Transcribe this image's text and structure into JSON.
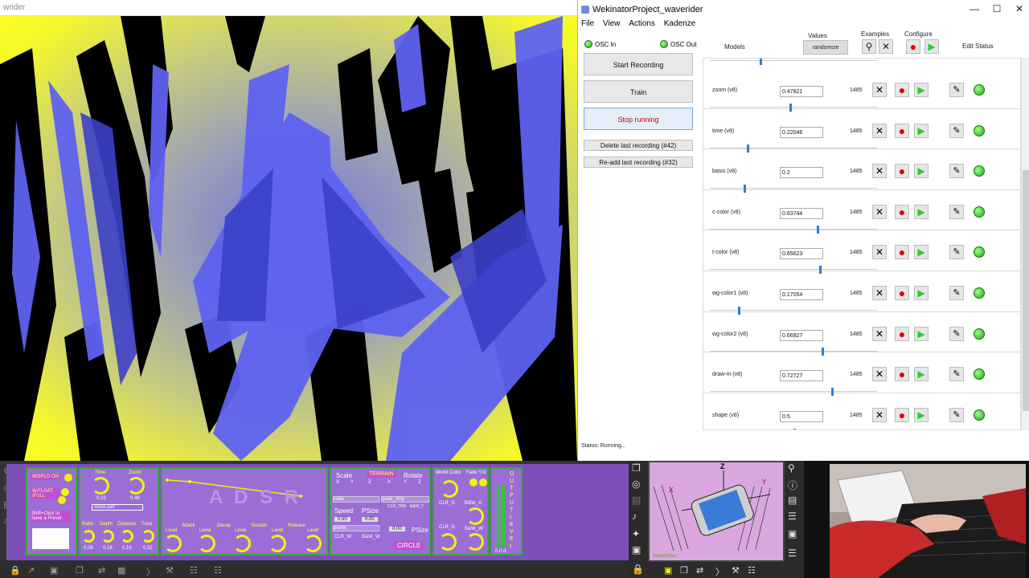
{
  "render_window": {
    "title": "wrider"
  },
  "wekinator": {
    "title": "WekinatorProject_waverider",
    "window_controls": [
      "—",
      "☐",
      "✕"
    ],
    "menu": [
      "File",
      "View",
      "Actions",
      "Kadenze"
    ],
    "osc_in": "OSC In",
    "osc_out": "OSC Out",
    "buttons": {
      "start_recording": "Start Recording",
      "train": "Train",
      "stop_running": "Stop running",
      "delete_last": "Delete last recording (#42)",
      "readd_last": "Re-add last recording (#32)"
    },
    "headers": {
      "models": "Models",
      "values": "Values",
      "randomize": "randomize",
      "examples": "Examples",
      "configure": "Configure",
      "edit": "Edit",
      "status": "Status"
    },
    "models": [
      {
        "name": "zoom (v8)",
        "value": "0.47821",
        "count": "1485",
        "slider": 0.47821
      },
      {
        "name": "time (v8)",
        "value": "0.22046",
        "count": "1485",
        "slider": 0.22046
      },
      {
        "name": "basis (v8)",
        "value": "0.2",
        "count": "1485",
        "slider": 0.2
      },
      {
        "name": "c-color (v8)",
        "value": "0.63744",
        "count": "1485",
        "slider": 0.63744
      },
      {
        "name": "t-color (v8)",
        "value": "0.65623",
        "count": "1485",
        "slider": 0.65623
      },
      {
        "name": "wg-color1 (v8)",
        "value": "0.17054",
        "count": "1485",
        "slider": 0.17054
      },
      {
        "name": "wg-color2 (v8)",
        "value": "0.66927",
        "count": "1485",
        "slider": 0.66927
      },
      {
        "name": "draw-m (v8)",
        "value": "0.72727",
        "count": "1485",
        "slider": 0.72727
      },
      {
        "name": "shape (v8)",
        "value": "0.5",
        "count": "1485",
        "slider": 0.5
      }
    ],
    "status": "Status:  Running..."
  },
  "synth": {
    "world_on": "WORLD ON",
    "w_float": "W.FLOAT /FULL",
    "preset_hint": "Shift+Click to Save a Preset",
    "time": "Time",
    "zoom": "Zoom",
    "time_value": "0.22",
    "zoom_value": "0.48",
    "noise_field": "noise.cell",
    "ratio": "Ratio",
    "depth": "Depth",
    "distance": "Distance",
    "tune": "Tune",
    "ratio_value": "0.06",
    "depth_value": "0.18",
    "distance_value": "0.10",
    "tune_value": "0.32",
    "adsr": "A D S R",
    "level": "Level",
    "attack": "Attack",
    "decay": "Decay",
    "sustain": "Sustain",
    "release": "Release",
    "scale": "Scale",
    "terrain": "TERRAIN",
    "rotate": "Rotate",
    "x": "X",
    "y": "Y",
    "z": "Z",
    "shape_select": "cube",
    "strip_select": "quad_strip",
    "clr_trn": "CLR_TRN",
    "bw_t": "B&W_T",
    "speed": "Speed",
    "psize": "PSize",
    "speed_value": "0.50",
    "psize_value": "0.00",
    "draw_select": "points",
    "psize2_value": "0.00",
    "psize_label": "PSize",
    "clr_w": "CLR_W",
    "bw_w": "B&W_W",
    "circle": "CIRCLE",
    "world_color": "World Color",
    "fade": "Fade Y.N",
    "clr_g": "CLR_G",
    "bw_g": "B&W_G",
    "clr_o": "CLR_G",
    "bw_o": "B&W_W",
    "output": "OUTPUT LEVEL",
    "out_value": "0.0 d"
  },
  "phone_thumb": {
    "z_label": "Z",
    "y_label": "Y",
    "x_label": "X",
    "caption": "WaveRider"
  }
}
